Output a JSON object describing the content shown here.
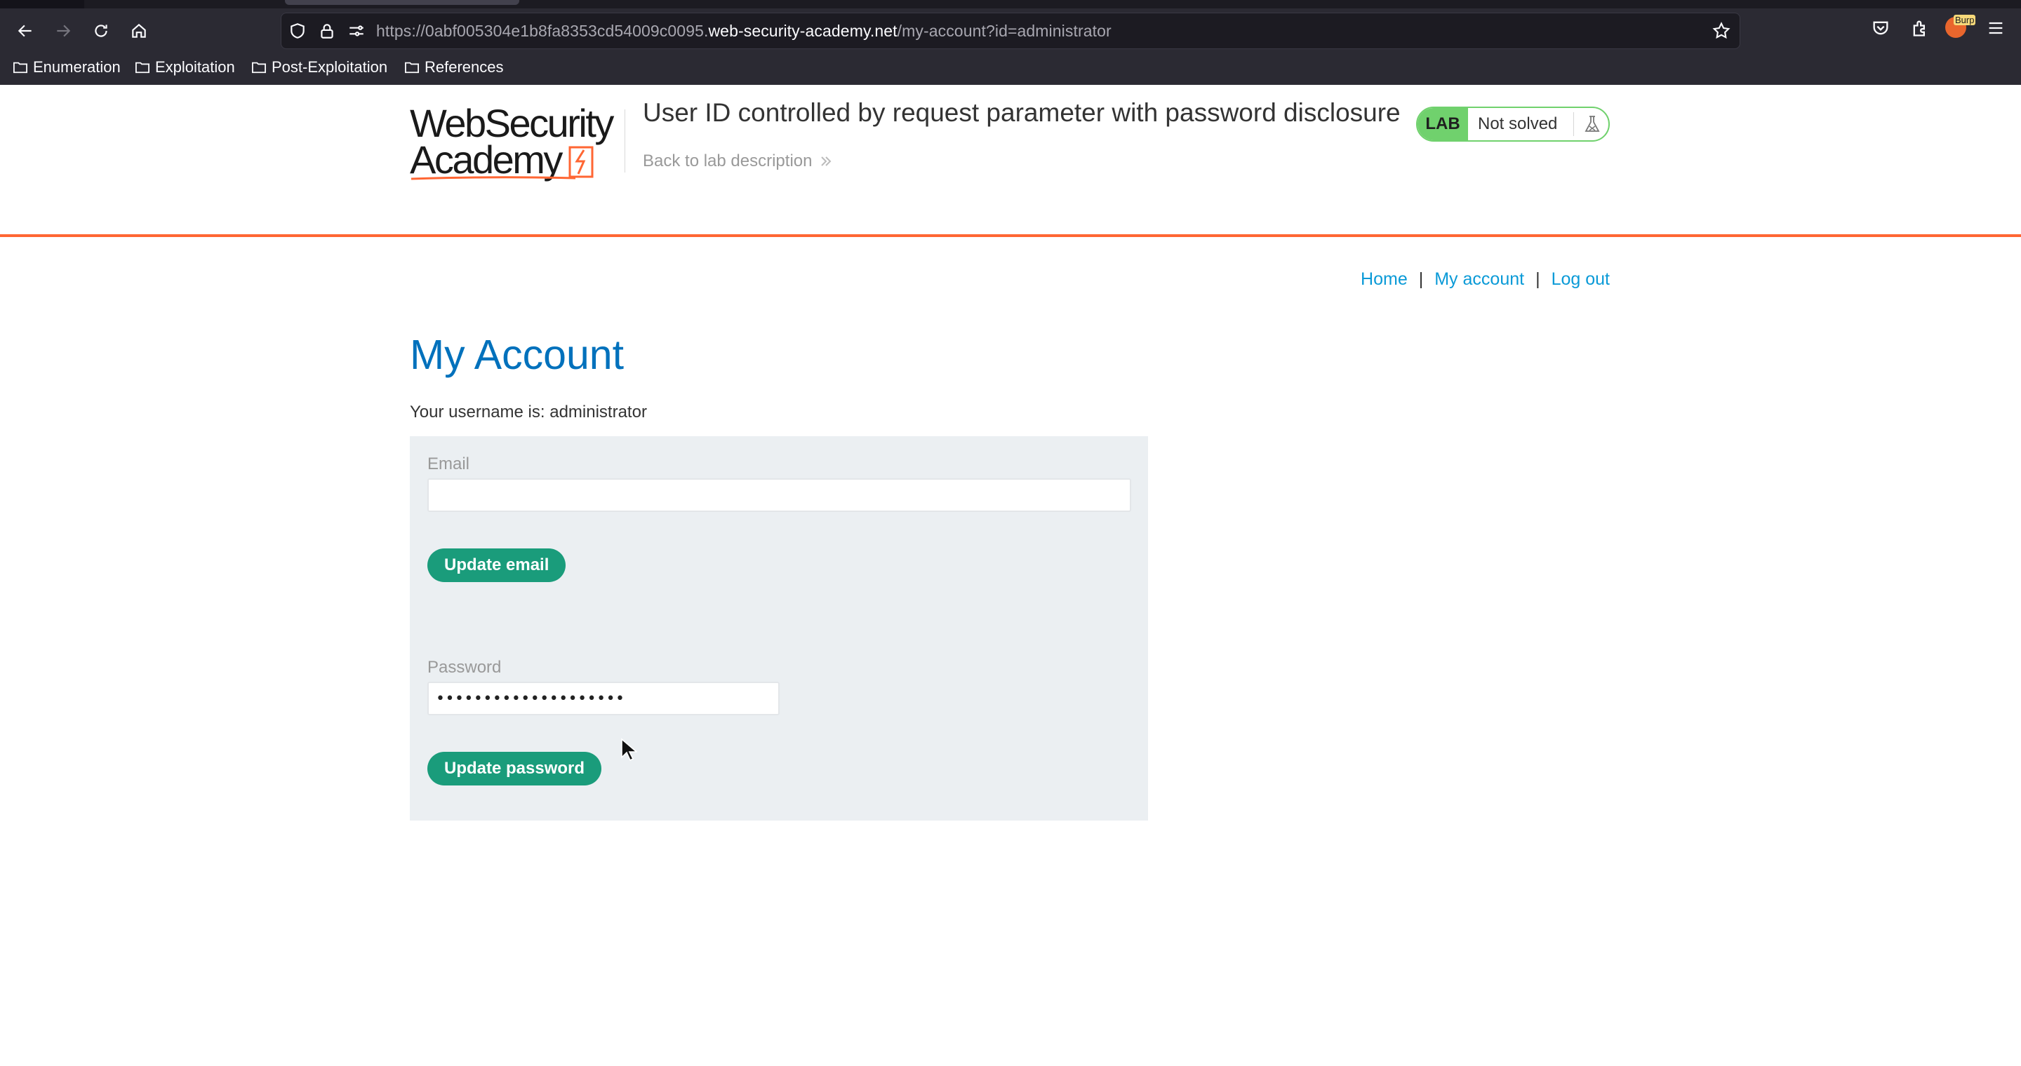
{
  "browser": {
    "url_prefix": "https://0abf005304e1b8fa8353cd54009c0095.",
    "url_host": "web-security-academy.net",
    "url_path": "/my-account?id=administrator",
    "extension_badge": "Burp",
    "bookmarks": [
      {
        "label": "Enumeration"
      },
      {
        "label": "Exploitation"
      },
      {
        "label": "Post-Exploitation"
      },
      {
        "label": "References"
      }
    ]
  },
  "lab": {
    "logo_line1": "WebSecurity",
    "logo_line2": "Academy",
    "title": "User ID controlled by request parameter with password disclosure",
    "back_link": "Back to lab description",
    "badge_tag": "LAB",
    "badge_status": "Not solved"
  },
  "nav": {
    "home": "Home",
    "separator": "|",
    "my_account": "My account",
    "logout": "Log out"
  },
  "account": {
    "title": "My Account",
    "username_line": "Your username is: administrator",
    "email_label": "Email",
    "email_value": "",
    "update_email_button": "Update email",
    "password_label": "Password",
    "password_value": "••••••••••••••••••••",
    "update_password_button": "Update password"
  },
  "colors": {
    "accent_orange": "#ff6633",
    "link_blue": "#0a9ad7",
    "title_blue": "#0071bc",
    "button_green": "#1a9c7b",
    "badge_green": "#70d16d"
  }
}
